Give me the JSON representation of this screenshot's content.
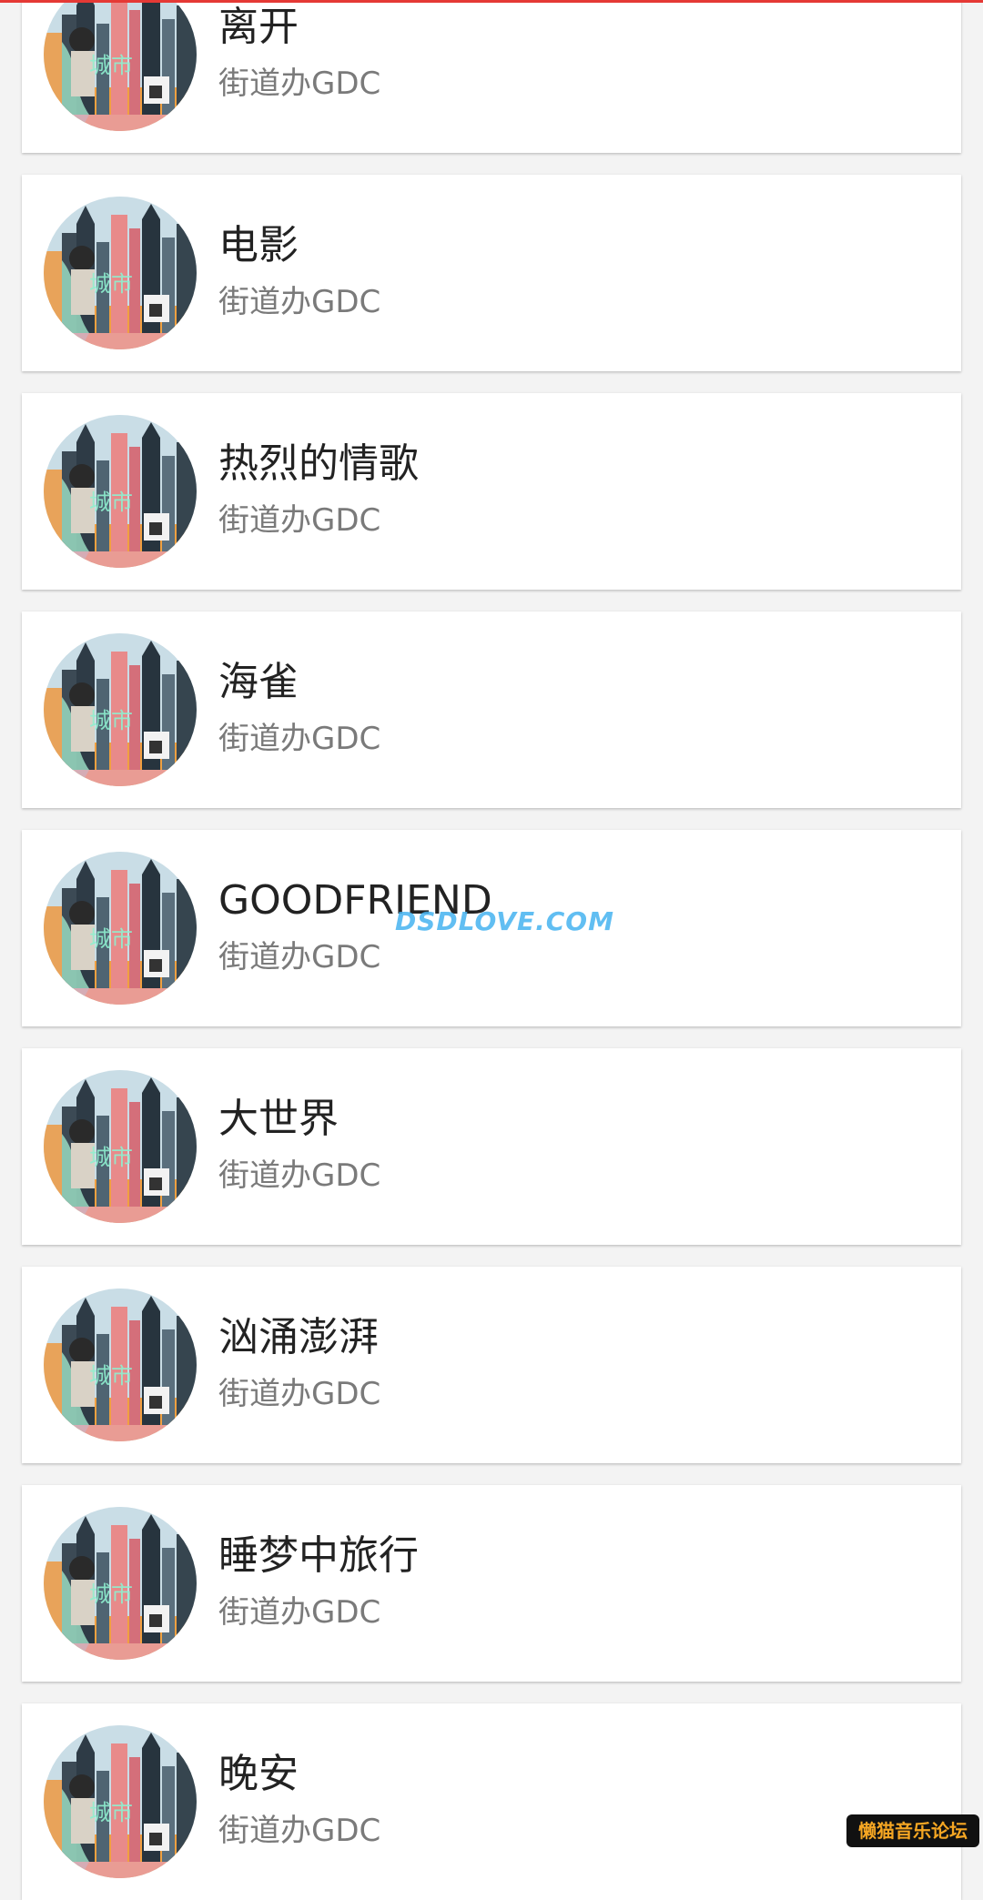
{
  "songs": [
    {
      "title": "离开",
      "artist": "街道办GDC"
    },
    {
      "title": "电影",
      "artist": "街道办GDC"
    },
    {
      "title": "热烈的情歌",
      "artist": "街道办GDC"
    },
    {
      "title": "海雀",
      "artist": "街道办GDC"
    },
    {
      "title": "GOODFRIEND",
      "artist": "街道办GDC"
    },
    {
      "title": "大世界",
      "artist": "街道办GDC"
    },
    {
      "title": "汹涌澎湃",
      "artist": "街道办GDC"
    },
    {
      "title": "睡梦中旅行",
      "artist": "街道办GDC"
    },
    {
      "title": "晚安",
      "artist": "街道办GDC"
    }
  ],
  "cover": {
    "text": "城市"
  },
  "watermarks": {
    "center": "DSDLOVE.COM",
    "badge": "懒猫音乐论坛"
  },
  "colors": {
    "accent": "#e53935",
    "title": "#222222",
    "subtitle": "#7a7a7a",
    "card": "#ffffff",
    "background": "#f3f3f3"
  }
}
